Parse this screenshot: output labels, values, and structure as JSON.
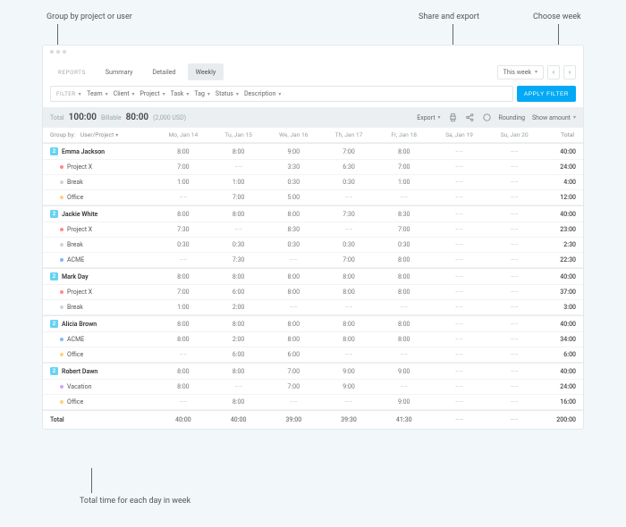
{
  "callouts": {
    "groupby": "Group by project or user",
    "share": "Share and export",
    "week": "Choose week",
    "totals": "Total time for each day in week"
  },
  "tabs": {
    "reports": "REPORTS",
    "summary": "Summary",
    "detailed": "Detailed",
    "weekly": "Weekly"
  },
  "week": {
    "label": "This week"
  },
  "filters": {
    "filter": "FILTER",
    "team": "Team",
    "client": "Client",
    "project": "Project",
    "task": "Task",
    "tag": "Tag",
    "status": "Status",
    "description": "Description",
    "apply": "APPLY FILTER"
  },
  "summary": {
    "totalL": "Total",
    "totalV": "100:00",
    "billL": "Billable",
    "billV": "80:00",
    "amount": "(2,000 USD)",
    "export": "Export",
    "rounding": "Rounding",
    "show": "Show amount"
  },
  "groupby": {
    "label": "Group by:",
    "value": "User/Project"
  },
  "days": [
    "Mo, Jan 14",
    "Tu, Jan 15",
    "We, Jan 16",
    "Th, Jan 17",
    "Fr, Jan 18",
    "Sa, Jan 19",
    "Su, Jan 20"
  ],
  "totalCol": "Total",
  "rows": [
    {
      "t": "u",
      "badge": "2",
      "name": "Emma Jackson",
      "d": [
        "8:00",
        "8:00",
        "9:00",
        "7:00",
        "8:00",
        "––",
        "––"
      ],
      "tot": "40:00"
    },
    {
      "t": "p",
      "c": "b-red",
      "name": "Project X",
      "d": [
        "7:00",
        "––",
        "3:30",
        "6:30",
        "7:00",
        "––",
        "––"
      ],
      "tot": "24:00"
    },
    {
      "t": "p",
      "c": "b-gray",
      "name": "Break",
      "d": [
        "1:00",
        "1:00",
        "0:30",
        "0:30",
        "1:00",
        "––",
        "––"
      ],
      "tot": "4:00"
    },
    {
      "t": "p",
      "c": "b-yellow",
      "name": "Office",
      "d": [
        "––",
        "7:00",
        "5:00",
        "––",
        "––",
        "––",
        "––"
      ],
      "tot": "12:00"
    },
    {
      "t": "u",
      "badge": "2",
      "name": "Jackie White",
      "d": [
        "8:00",
        "8:00",
        "8:00",
        "7:30",
        "8:30",
        "––",
        "––"
      ],
      "tot": "40:00"
    },
    {
      "t": "p",
      "c": "b-red",
      "name": "Project X",
      "d": [
        "7:30",
        "––",
        "8:30",
        "––",
        "7:00",
        "––",
        "––"
      ],
      "tot": "23:00"
    },
    {
      "t": "p",
      "c": "b-gray",
      "name": "Break",
      "d": [
        "0:30",
        "0:30",
        "0:30",
        "0:30",
        "0:30",
        "––",
        "––"
      ],
      "tot": "2:30"
    },
    {
      "t": "p",
      "c": "b-blue",
      "name": "ACME",
      "d": [
        "––",
        "7:30",
        "––",
        "7:00",
        "8:00",
        "––",
        "––"
      ],
      "tot": "22:30"
    },
    {
      "t": "u",
      "badge": "2",
      "name": "Mark Day",
      "d": [
        "8:00",
        "8:00",
        "8:00",
        "8:00",
        "8:00",
        "––",
        "––"
      ],
      "tot": "40:00"
    },
    {
      "t": "p",
      "c": "b-red",
      "name": "Project X",
      "d": [
        "7:00",
        "6:00",
        "8:00",
        "8:00",
        "8:00",
        "––",
        "––"
      ],
      "tot": "37:00"
    },
    {
      "t": "p",
      "c": "b-gray",
      "name": "Break",
      "d": [
        "1:00",
        "2:00",
        "––",
        "––",
        "––",
        "––",
        "––"
      ],
      "tot": "3:00"
    },
    {
      "t": "u",
      "badge": "2",
      "name": "Alicia Brown",
      "d": [
        "8:00",
        "8:00",
        "8:00",
        "8:00",
        "8:00",
        "––",
        "––"
      ],
      "tot": "40:00"
    },
    {
      "t": "p",
      "c": "b-blue",
      "name": "ACME",
      "d": [
        "8:00",
        "2:00",
        "8:00",
        "8:00",
        "8:00",
        "––",
        "––"
      ],
      "tot": "34:00"
    },
    {
      "t": "p",
      "c": "b-yellow",
      "name": "Office",
      "d": [
        "––",
        "6:00",
        "6:00",
        "––",
        "––",
        "––",
        "––"
      ],
      "tot": "6:00"
    },
    {
      "t": "u",
      "badge": "2",
      "name": "Robert Dawn",
      "d": [
        "8:00",
        "8:00",
        "7:00",
        "9:00",
        "9:00",
        "––",
        "––"
      ],
      "tot": "40:00"
    },
    {
      "t": "p",
      "c": "b-purple",
      "name": "Vacation",
      "d": [
        "8:00",
        "––",
        "7:00",
        "9:00",
        "––",
        "––",
        "––"
      ],
      "tot": "24:00"
    },
    {
      "t": "p",
      "c": "b-yellow",
      "name": "Office",
      "d": [
        "––",
        "8:00",
        "––",
        "––",
        "9:00",
        "––",
        "––"
      ],
      "tot": "16:00"
    }
  ],
  "totals": {
    "name": "Total",
    "d": [
      "40:00",
      "40:00",
      "39:00",
      "39:30",
      "41:30",
      "––",
      "––"
    ],
    "tot": "200:00"
  }
}
